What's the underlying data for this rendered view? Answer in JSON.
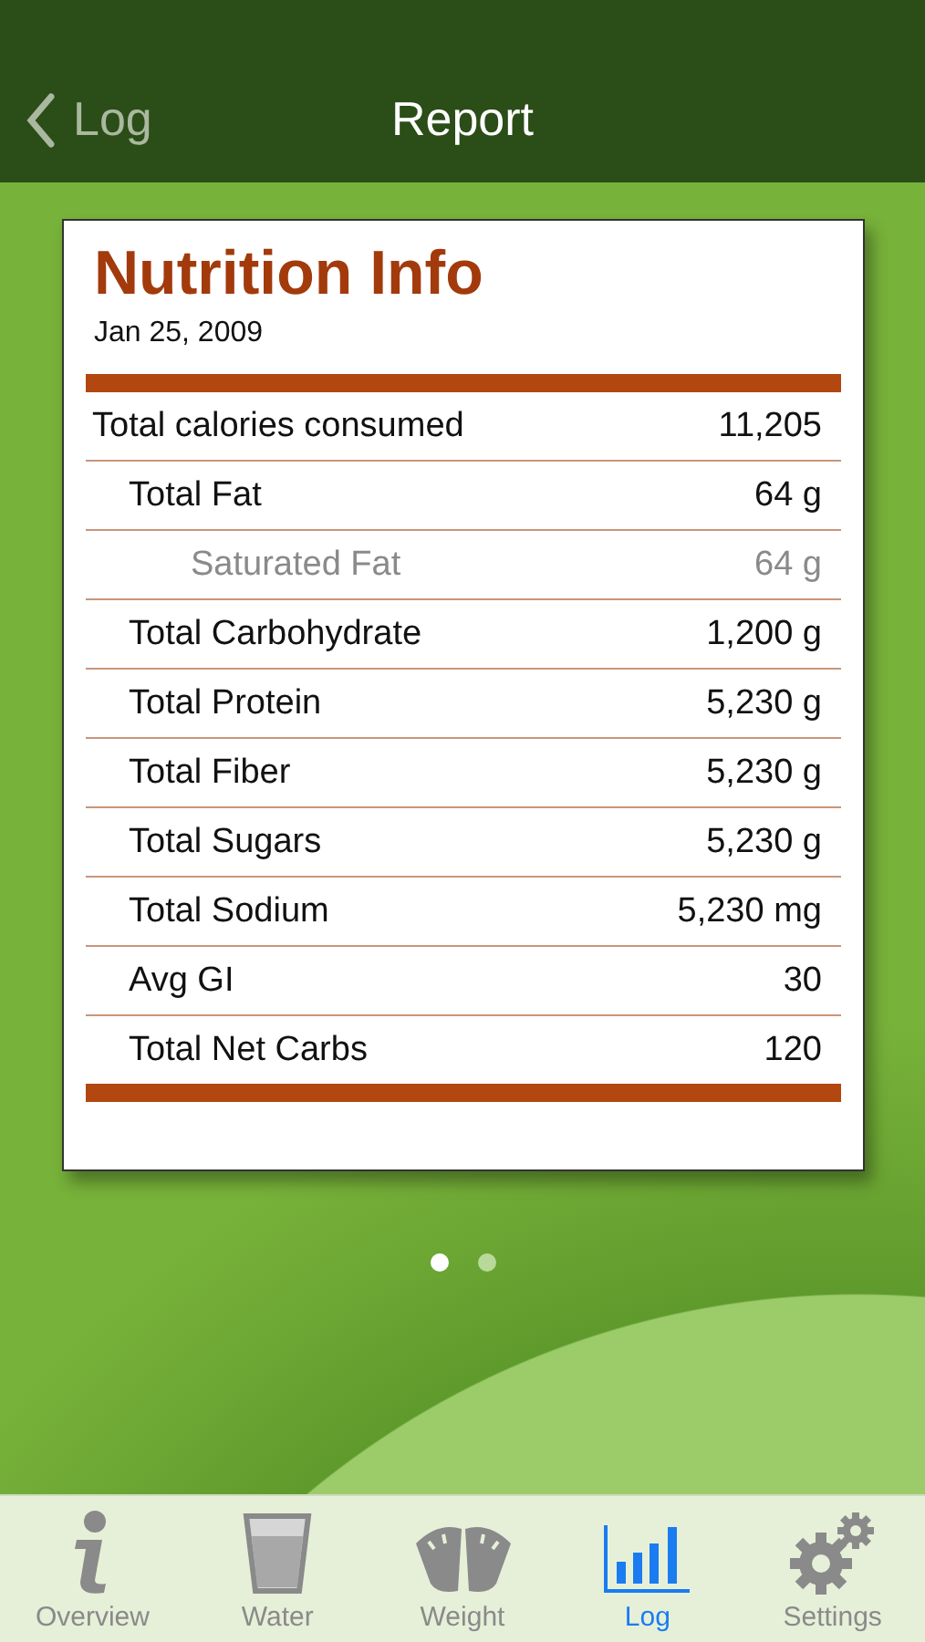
{
  "nav_bar": {
    "back_label": "Log",
    "title": "Report"
  },
  "card": {
    "title": "Nutrition Info",
    "date": "Jan 25, 2009",
    "rows": [
      {
        "label": "Total calories consumed",
        "value": "11,205",
        "children": [
          {
            "label": "Total Fat",
            "value": "64 g",
            "children": [
              {
                "label": "Saturated Fat",
                "value": "64 g"
              }
            ]
          },
          {
            "label": "Total Carbohydrate",
            "value": "1,200 g"
          },
          {
            "label": "Total Protein",
            "value": "5,230 g"
          },
          {
            "label": "Total Fiber",
            "value": "5,230 g"
          },
          {
            "label": "Total Sugars",
            "value": "5,230 g"
          },
          {
            "label": "Total Sodium",
            "value": "5,230 mg"
          },
          {
            "label": "Avg GI",
            "value": "30"
          },
          {
            "label": "Total Net Carbs",
            "value": "120"
          }
        ]
      }
    ]
  },
  "page_dots": [
    {
      "selected": true
    },
    {
      "selected": false
    }
  ],
  "tabs": [
    {
      "kind": "info",
      "label": "Overview",
      "selected": false
    },
    {
      "kind": "glass",
      "label": "Water",
      "selected": false
    },
    {
      "kind": "scale",
      "label": "Weight",
      "selected": false
    },
    {
      "kind": "chart",
      "label": "Log",
      "selected": true
    },
    {
      "kind": "gears",
      "label": "Settings",
      "selected": false
    }
  ]
}
